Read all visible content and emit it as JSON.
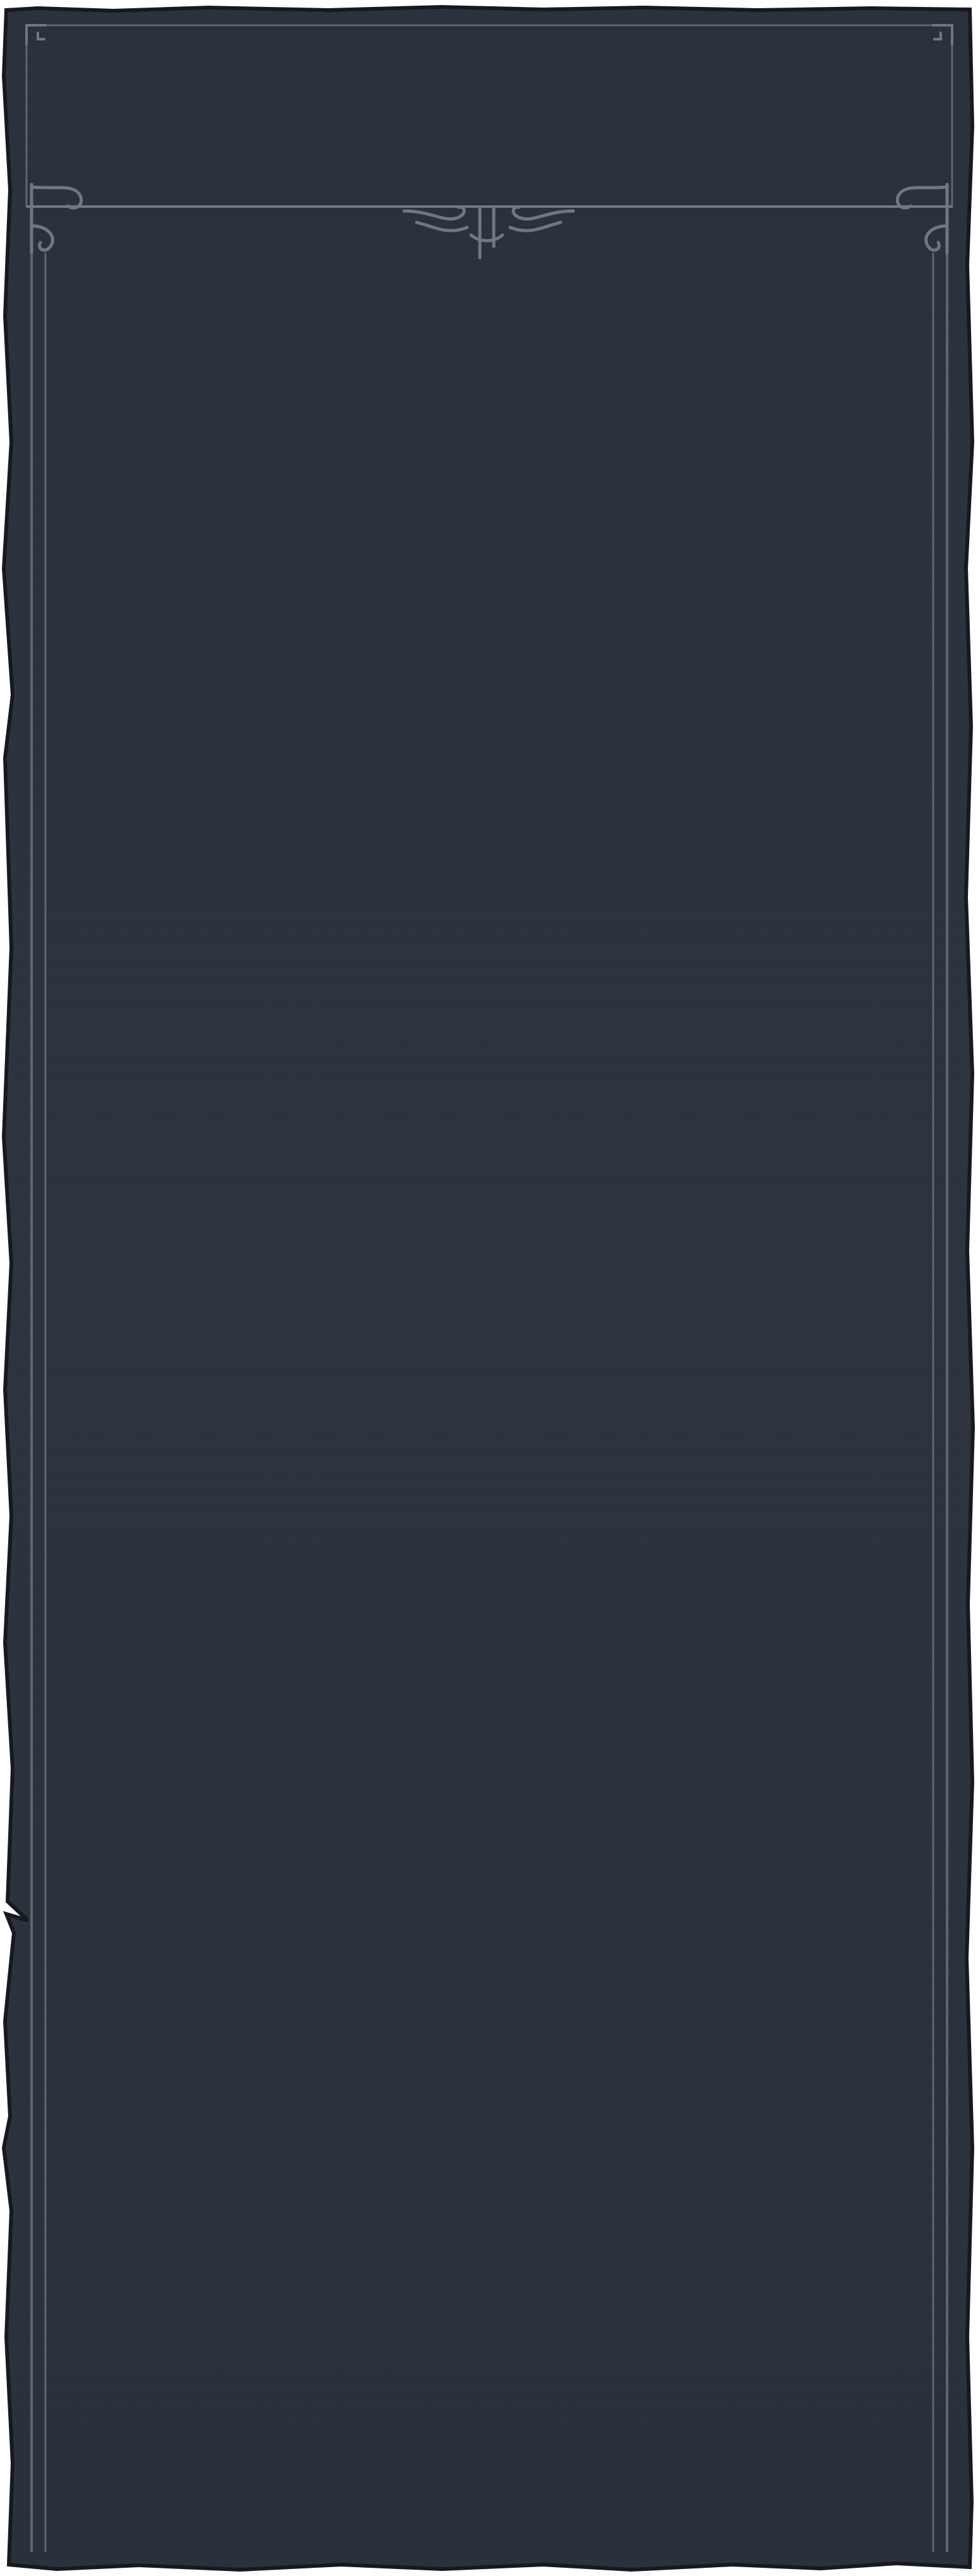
{
  "panel": {
    "kind": "ornate-scroll-panel",
    "colors": {
      "background": "#ffffff",
      "panel_fill": "#2d333e",
      "panel_edge": "#16191f",
      "frame_line": "#5a6870",
      "frame_line_highlight": "#6c7c82",
      "ornament": "#6a7a80"
    },
    "icons": [
      "corner-flourish-icon",
      "center-scroll-ornament-icon"
    ]
  }
}
